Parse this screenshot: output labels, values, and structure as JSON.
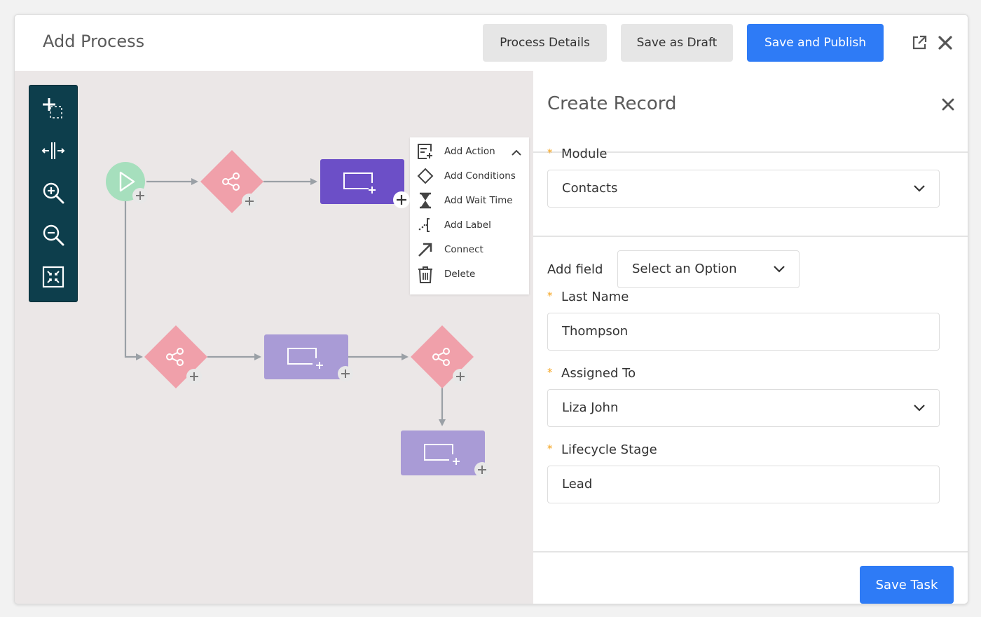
{
  "header": {
    "title": "Add Process",
    "buttons": {
      "process_details": "Process Details",
      "save_as_draft": "Save as Draft",
      "save_and_publish": "Save and Publish"
    },
    "icons": [
      "external-link-icon",
      "close-icon"
    ]
  },
  "toolbar": {
    "tools": [
      "add-selection-icon",
      "spread-horizontal-icon",
      "zoom-in-icon",
      "zoom-out-icon",
      "fit-to-screen-icon"
    ]
  },
  "context_menu": {
    "items": [
      {
        "label": "Add Action",
        "icon": "add-action-icon"
      },
      {
        "label": "Add Conditions",
        "icon": "diamond-icon"
      },
      {
        "label": "Add Wait Time",
        "icon": "hourglass-icon"
      },
      {
        "label": "Add Label",
        "icon": "label-icon"
      },
      {
        "label": "Connect",
        "icon": "arrow-up-right-icon"
      },
      {
        "label": "Delete",
        "icon": "trash-icon"
      }
    ]
  },
  "panel": {
    "title": "Create Record",
    "module": {
      "label": "Module",
      "value": "Contacts"
    },
    "add_field": {
      "label": "Add field",
      "value": "Select an Option"
    },
    "last_name": {
      "label": "Last Name",
      "value": "Thompson"
    },
    "assigned_to": {
      "label": "Assigned To",
      "value": "Liza John"
    },
    "lifecycle_stage": {
      "label": "Lifecycle Stage",
      "value": "Lead"
    },
    "save_task": "Save Task"
  },
  "colors": {
    "primary": "#2e7bf6",
    "toolbar": "#0d3e4c",
    "action_selected": "#6c4fc7",
    "action": "#a99bd6",
    "condition": "#f0a0aa",
    "start": "#a6dfbd",
    "required": "#f5a623"
  }
}
